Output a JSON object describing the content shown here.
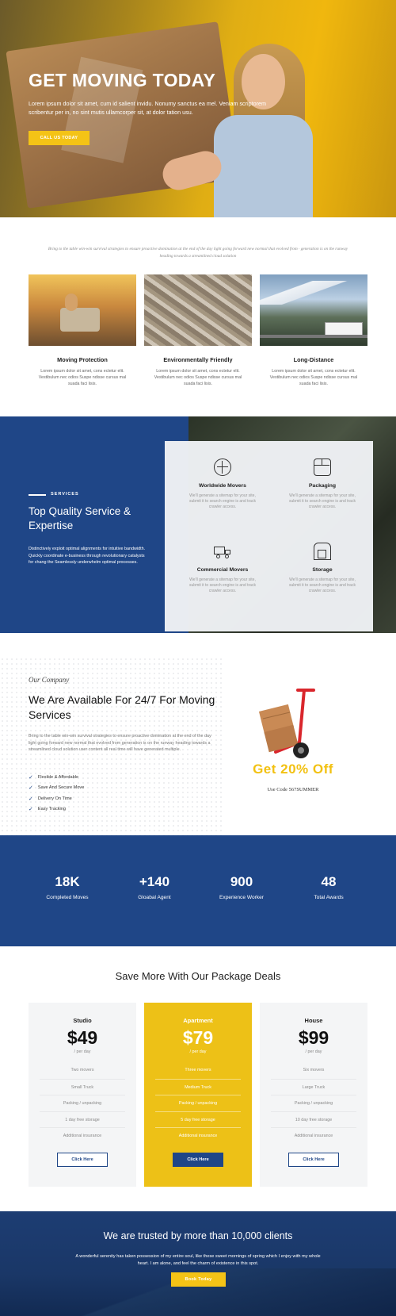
{
  "hero": {
    "title": "GET MOVING TODAY",
    "text": "Lorem ipsum dolor sit amet, cum id salient invidu. Nonumy sanctus ea mel. Veniam scriptorem scribentur per in, no sint mutis ullamcorper sit, at dolor tation usu.",
    "button": "CALL US TODAY"
  },
  "intro": {
    "text": "Bring to the table win-win survival strategies to ensure proactive domination at the end of the day light going forward new normal that evolved from · generation is on the runway heading towards a streamlined cloud solution"
  },
  "services_cards": [
    {
      "title": "Moving Protection",
      "text": "Lorem ipsum dolor sit amet, cons ectetur elit. Vestibulum nec odios Suspe ndisse cursus mal suada faci lisis."
    },
    {
      "title": "Environmentally Friendly",
      "text": "Lorem ipsum dolor sit amet, cons ectetur elit. Vestibulum nec odios Suspe ndisse cursus mal suada faci lisis."
    },
    {
      "title": "Long-Distance",
      "text": "Lorem ipsum dolor sit amet, cons ectetur elit. Vestibulum nec odios Suspe ndisse cursus mal suada faci lisis."
    }
  ],
  "services": {
    "tag": "SERVICES",
    "title": "Top Quality Service & Expertise",
    "text": "Distinctively exploit optimal alignments for intuitive bandwidth. Quickly coordinate e-business through revolutionary catalysts for chang the Seamlessly underwhelm optimal processes.",
    "items": [
      {
        "title": "Worldwide Movers",
        "text": "We'll generate a sitemap for your site, submit it to search engine is and track crawler access."
      },
      {
        "title": "Packaging",
        "text": "We'll generate a sitemap for your site, submit it to search engine is and track crawler access."
      },
      {
        "title": "Commercial Movers",
        "text": "We'll generate a sitemap for your site, submit it to search engine is and track crawler access."
      },
      {
        "title": "Storage",
        "text": "We'll generate a sitemap for your site, submit it to search engine is and track crawler access."
      }
    ]
  },
  "company": {
    "label": "Our Company",
    "title": "We Are Available For 24/7 For Moving Services",
    "text": "Bring to the table win-win survival strategies to ensure proactive domination at the end of the day light going forward new normal that evolved from generation is on the runway heading towards a streamlined cloud solution user content all real time will have generated multiple.",
    "list": [
      "Flexible & Affordable",
      "Save And Secure Move",
      "Delivery On Time",
      "Easy Tracking"
    ],
    "promo": "Get 20% Off",
    "promo_code": "Use Code 567SUMMER"
  },
  "stats": [
    {
      "num": "18K",
      "label": "Completed Moves"
    },
    {
      "num": "+140",
      "label": "Gloabal Agent"
    },
    {
      "num": "900",
      "label": "Experience Worker"
    },
    {
      "num": "48",
      "label": "Total Awards"
    }
  ],
  "pricing": {
    "title": "Save More With Our Package Deals",
    "plans": [
      {
        "name": "Studio",
        "price": "$49",
        "per": "/ per day",
        "features": [
          "Two movers",
          "Small Truck",
          "Packing / unpacking",
          "1 day free storage",
          "Additional insurance"
        ],
        "cta": "Click Here"
      },
      {
        "name": "Apartment",
        "price": "$79",
        "per": "/ per day",
        "features": [
          "Three movers",
          "Medium Truck",
          "Packing / unpacking",
          "5 day free storage",
          "Additional insurance"
        ],
        "cta": "Click Here"
      },
      {
        "name": "House",
        "price": "$99",
        "per": "/ per day",
        "features": [
          "Six movers",
          "Large Truck",
          "Packing / unpacking",
          "10 day free storage",
          "Additional insurance"
        ],
        "cta": "Click Here"
      }
    ]
  },
  "trust": {
    "title": "We are trusted by more than 10,000 clients",
    "text": "A wonderful serenity has taken possession of my entire soul, like these sweet mornings of spring which I enjoy with my whole heart. I am alone, and feel the charm of existence in this spot.",
    "button": "Book Today"
  }
}
